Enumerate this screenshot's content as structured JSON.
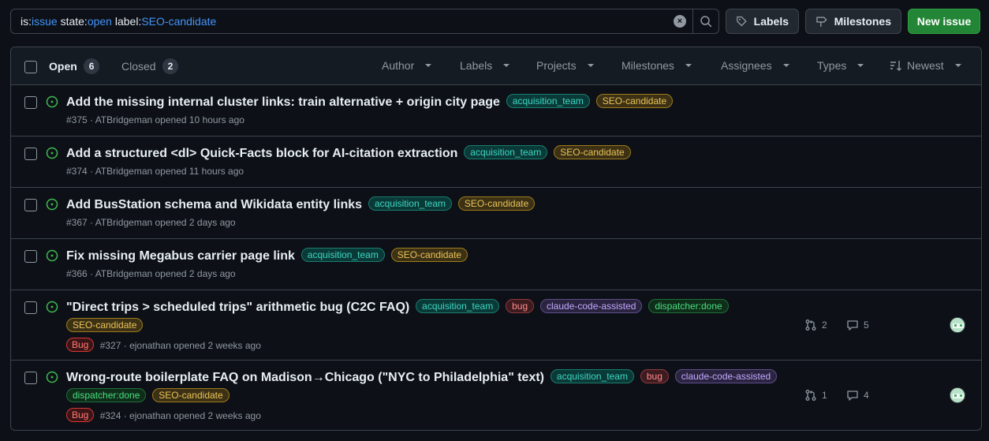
{
  "search": {
    "tokens": [
      {
        "key": "is:",
        "val": "issue"
      },
      {
        "key": " state:",
        "val": "open"
      },
      {
        "key": " label:",
        "val": "SEO-candidate"
      }
    ]
  },
  "toolbar": {
    "labels_label": "Labels",
    "milestones_label": "Milestones",
    "new_issue_label": "New issue"
  },
  "tabs": {
    "open_label": "Open",
    "open_count": "6",
    "closed_label": "Closed",
    "closed_count": "2"
  },
  "filters": [
    "Author",
    "Labels",
    "Projects",
    "Milestones",
    "Assignees",
    "Types",
    "Newest"
  ],
  "colors": {
    "open_icon": "#3fb950",
    "primary_button": "#238636",
    "link_blue": "#4493f8"
  },
  "issues": [
    {
      "title": "Add the missing internal cluster links: train alternative + origin city page",
      "labels": [
        "acquisition_team",
        "SEO-candidate"
      ],
      "meta": "#375 · ATBridgeman opened 10 hours ago"
    },
    {
      "title": "Add a structured <dl> Quick-Facts block for AI-citation extraction",
      "labels": [
        "acquisition_team",
        "SEO-candidate"
      ],
      "meta": "#374 · ATBridgeman opened 11 hours ago"
    },
    {
      "title": "Add BusStation schema and Wikidata entity links",
      "labels": [
        "acquisition_team",
        "SEO-candidate"
      ],
      "meta": "#367 · ATBridgeman opened 2 days ago"
    },
    {
      "title": "Fix missing Megabus carrier page link",
      "labels": [
        "acquisition_team",
        "SEO-candidate"
      ],
      "meta": "#366 · ATBridgeman opened 2 days ago"
    },
    {
      "title": "\"Direct trips > scheduled trips\" arithmetic bug (C2C FAQ)",
      "labels": [
        "acquisition_team",
        "bug",
        "claude-code-assisted",
        "dispatcher:done"
      ],
      "labels2": [
        "SEO-candidate"
      ],
      "type": "Bug",
      "meta": "#327 · ejonathan opened 2 weeks ago",
      "prs": "2",
      "comments": "5"
    },
    {
      "title": "Wrong-route boilerplate FAQ on Madison→Chicago (\"NYC to Philadelphia\" text)",
      "labels": [
        "acquisition_team",
        "bug",
        "claude-code-assisted"
      ],
      "labels2": [
        "dispatcher:done",
        "SEO-candidate"
      ],
      "type": "Bug",
      "meta": "#324 · ejonathan opened 2 weeks ago",
      "prs": "1",
      "comments": "4"
    }
  ]
}
